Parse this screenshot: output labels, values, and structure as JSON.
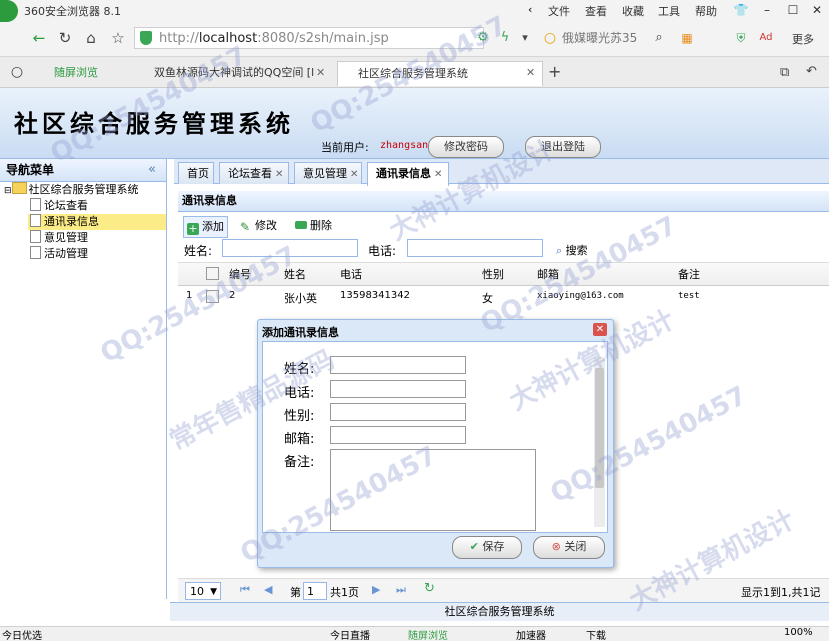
{
  "browser": {
    "title": "360安全浏览器 8.1",
    "menu": [
      "文件",
      "查看",
      "收藏",
      "工具",
      "帮助"
    ],
    "url_prefix": "http://",
    "url_host": "localhost",
    "url_rest": ":8080/s2sh/main.jsp",
    "search_text": "俄媒曝光苏35",
    "more_label": "更多",
    "tabs": [
      {
        "label": "随屏浏览"
      },
      {
        "label": "双鱼林源码大神调试的QQ空间 [l"
      },
      {
        "label": "社区综合服务管理系统"
      }
    ],
    "status_left": "今日优选",
    "status_items": [
      "今日直播",
      "随屏浏览",
      "加速器",
      "下载"
    ],
    "zoom": "100%"
  },
  "app": {
    "title": "社区综合服务管理系统",
    "user_label": "当前用户:",
    "user_name": "zhangsan",
    "change_password": "修改密码",
    "logout": "退出登陆",
    "footer": "社区综合服务管理系统"
  },
  "sidebar": {
    "header": "导航菜单",
    "collapse": "«",
    "root": "社区综合服务管理系统",
    "items": [
      {
        "label": "论坛查看"
      },
      {
        "label": "通讯录信息"
      },
      {
        "label": "意见管理"
      },
      {
        "label": "活动管理"
      }
    ]
  },
  "content_tabs": [
    {
      "label": "首页"
    },
    {
      "label": "论坛查看"
    },
    {
      "label": "意见管理"
    },
    {
      "label": "通讯录信息"
    }
  ],
  "panel": {
    "title": "通讯录信息",
    "add": "添加",
    "edit": "修改",
    "delete": "删除",
    "name_label": "姓名:",
    "phone_label": "电话:",
    "search": "搜索"
  },
  "grid": {
    "columns": [
      "编号",
      "姓名",
      "电话",
      "性别",
      "邮箱",
      "备注"
    ],
    "rows": [
      {
        "index": "1",
        "id": "2",
        "name": "张小英",
        "phone": "13598341342",
        "gender": "女",
        "email": "xiaoying@163.com",
        "note": "test"
      }
    ]
  },
  "pager": {
    "page_size": "10",
    "page_prefix": "第",
    "page": "1",
    "page_suffix": "共1页",
    "info": "显示1到1,共1记录"
  },
  "dialog": {
    "title": "添加通讯录信息",
    "fields": [
      {
        "label": "姓名:"
      },
      {
        "label": "电话:"
      },
      {
        "label": "性别:"
      },
      {
        "label": "邮箱:"
      },
      {
        "label": "备注:"
      }
    ],
    "save": "保存",
    "close": "关闭"
  },
  "watermarks": [
    "QQ:254540457",
    "常年售精品源码",
    "大神计算机设计"
  ]
}
